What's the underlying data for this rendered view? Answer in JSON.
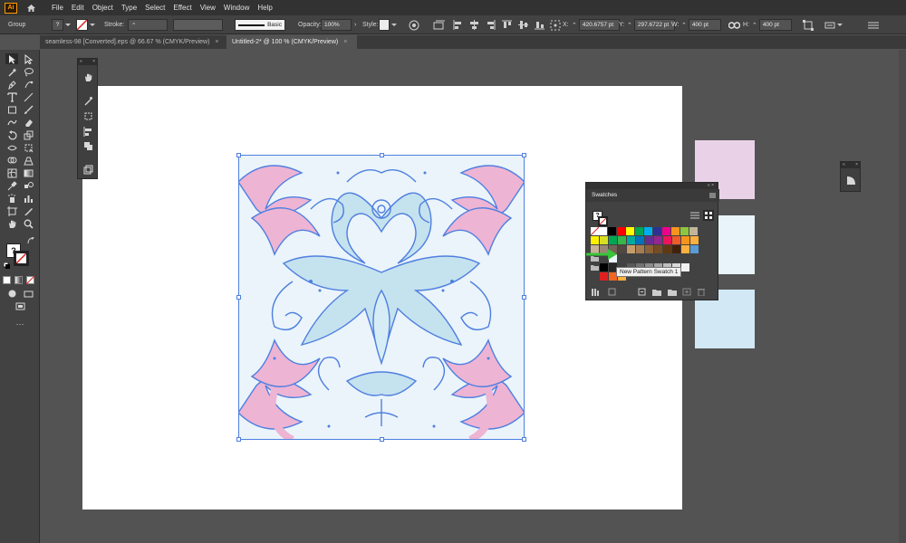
{
  "menubar": {
    "app_icon": "Ai",
    "items": [
      "File",
      "Edit",
      "Object",
      "Type",
      "Select",
      "Effect",
      "View",
      "Window",
      "Help"
    ]
  },
  "controlbar": {
    "selection_type": "Group",
    "fill_symbol": "?",
    "stroke_label": "Stroke:",
    "stroke_style": "Basic",
    "opacity_label": "Opacity:",
    "opacity_value": "100%",
    "style_label": "Style:",
    "x_label": "X:",
    "x_value": "420.6757 pt",
    "y_label": "Y:",
    "y_value": "297.6722 pt",
    "w_label": "W:",
    "w_value": "400 pt",
    "h_label": "H:",
    "h_value": "400 pt"
  },
  "tabs": [
    {
      "label": "seamless-98 [Converted].eps @ 66.67 % (CMYK/Preview)",
      "close": "×",
      "active": false
    },
    {
      "label": "Untitled-2* @ 100 % (CMYK/Preview)",
      "close": "×",
      "active": true
    }
  ],
  "swatches_panel": {
    "title": "Swatches",
    "tooltip": "New Pattern Swatch 1",
    "swatch_colors_row1": [
      "#ffffff",
      "#000000",
      "#ff0000",
      "#ffff00",
      "#00a651",
      "#00aeef",
      "#2e3192",
      "#ec008c",
      "#f7941d",
      "#8dc63f",
      "#c2b59b",
      "#f26522"
    ],
    "swatch_colors_row2": [
      "#fff200",
      "#d7df23",
      "#00a651",
      "#39b54a",
      "#00a99d",
      "#0072bc",
      "#662d91",
      "#92278f",
      "#ed145b",
      "#f15a29",
      "#f7941d",
      "#fbb040"
    ],
    "swatch_colors_row3": [
      "#c7b299",
      "#998675",
      "#736357",
      "#534741",
      "#c69c6d",
      "#a67c52",
      "#8c6239",
      "#754c24",
      "#603913",
      "#42210b",
      "#fbb040",
      "#5b9bd5"
    ],
    "gray_swatches": [
      "#000000",
      "#262626",
      "#404040",
      "#595959",
      "#737373",
      "#8c8c8c",
      "#a6a6a6",
      "#bfbfbf",
      "#d9d9d9",
      "#f2f2f2"
    ]
  },
  "artboard_swatches": [
    "#e9d2e8",
    "#e8f4f9",
    "#d2e8f4"
  ],
  "colors": {
    "pattern_pink": "#eeb4d4",
    "pattern_blue": "#4f7fe0",
    "pattern_light_blue": "#c5e2ef",
    "arrow_green": "#39c43a"
  }
}
